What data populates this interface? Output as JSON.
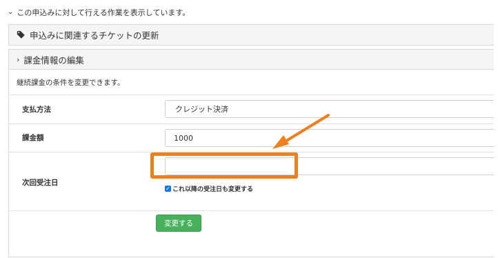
{
  "header": {
    "summary": "この申込みに対して行える作業を表示しています。"
  },
  "panels": {
    "ticket_update": {
      "title": "申込みに関連するチケットの更新"
    },
    "billing_edit": {
      "title": "課金情報の編集",
      "description": "継続課金の条件を変更できます。",
      "payment_method": {
        "label": "支払方法",
        "value": "クレジット決済"
      },
      "amount": {
        "label": "課金額",
        "value": "1000"
      },
      "next_order_date": {
        "label": "次回受注日",
        "value": "",
        "checkbox_label": "これ以降の受注日も変更する",
        "checkbox_checked": true
      },
      "submit_label": "変更する"
    }
  },
  "icons": {
    "top_toggle": "chevron-down-icon",
    "ticket_panel": "tag-icon",
    "billing_panel": "chevron-right-icon"
  },
  "colors": {
    "highlight": "#f07f1c",
    "submit_button": "#47b05a",
    "checkbox": "#1a73e8"
  }
}
